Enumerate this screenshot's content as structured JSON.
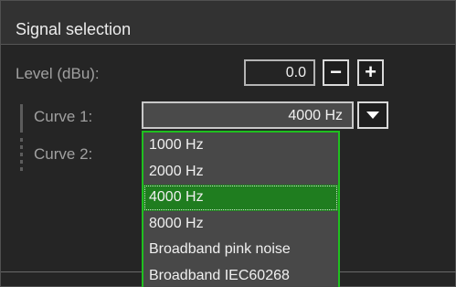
{
  "panel": {
    "title": "Signal selection"
  },
  "level": {
    "label": "Level (dBu):",
    "value": "0.0",
    "minus": "−",
    "plus": "+"
  },
  "curve1": {
    "label": "Curve 1:",
    "value": "4000 Hz"
  },
  "curve2": {
    "label": "Curve 2:"
  },
  "dropdown": {
    "options": [
      "1000 Hz",
      "2000 Hz",
      "4000 Hz",
      "8000 Hz",
      "Broadband pink noise",
      "Broadband IEC60268"
    ],
    "selected_index": 2
  },
  "colors": {
    "accent": "#1fbf1f",
    "selected_bg": "#1f7d1f"
  },
  "icons": {
    "dropdown": "chevron-down-icon"
  }
}
